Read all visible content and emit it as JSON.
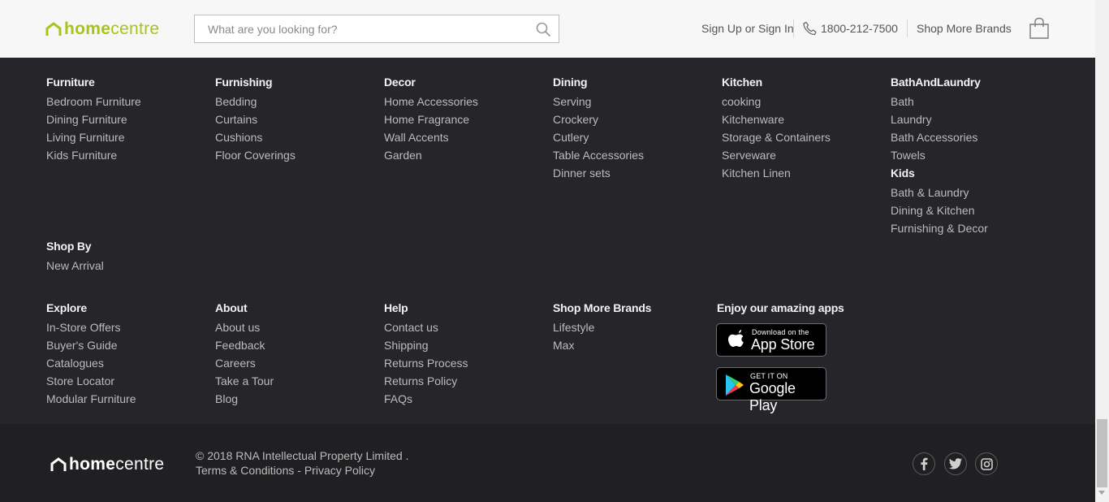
{
  "header": {
    "logo_bold": "home",
    "logo_thin": "centre",
    "search_placeholder": "What are you looking for?",
    "signin": "Sign Up or Sign In",
    "phone": "1800-212-7500",
    "shop_more": "Shop More Brands",
    "accent_color": "#a8c41a"
  },
  "categories": [
    {
      "heading": "Furniture",
      "links": [
        "Bedroom Furniture",
        "Dining Furniture",
        "Living Furniture",
        "Kids Furniture"
      ]
    },
    {
      "heading": "Furnishing",
      "links": [
        "Bedding",
        "Curtains",
        "Cushions",
        "Floor Coverings"
      ]
    },
    {
      "heading": "Decor",
      "links": [
        "Home Accessories",
        "Home Fragrance",
        "Wall Accents",
        "Garden"
      ]
    },
    {
      "heading": "Dining",
      "links": [
        "Serving",
        "Crockery",
        "Cutlery",
        "Table Accessories",
        "Dinner sets"
      ]
    },
    {
      "heading": "Kitchen",
      "links": [
        "cooking",
        "Kitchenware",
        "Storage & Containers",
        "Serveware",
        "Kitchen Linen"
      ]
    },
    {
      "heading": "BathAndLaundry",
      "links": [
        "Bath",
        "Laundry",
        "Bath Accessories",
        "Towels"
      ]
    }
  ],
  "kids": {
    "heading": "Kids",
    "links": [
      "Bath & Laundry",
      "Dining & Kitchen",
      "Furnishing & Decor"
    ]
  },
  "shop_by": {
    "heading": "Shop By",
    "links": [
      "New Arrival"
    ]
  },
  "info": [
    {
      "heading": "Explore",
      "links": [
        "In-Store Offers",
        "Buyer's Guide",
        "Catalogues",
        "Store Locator",
        "Modular Furniture"
      ]
    },
    {
      "heading": "About",
      "links": [
        "About us",
        "Feedback",
        "Careers",
        "Take a Tour",
        "Blog"
      ]
    },
    {
      "heading": "Help",
      "links": [
        "Contact us",
        "Shipping",
        "Returns Process",
        "Returns Policy",
        "FAQs"
      ]
    },
    {
      "heading": "Shop More Brands",
      "links": [
        "Lifestyle",
        "Max"
      ]
    }
  ],
  "apps": {
    "heading": "Enjoy our amazing apps",
    "appstore_small": "Download on the",
    "appstore_big": "App Store",
    "googleplay_small": "GET IT ON",
    "googleplay_big": "Google Play"
  },
  "bottom": {
    "logo_bold": "home",
    "logo_thin": "centre",
    "copyright": "© 2018 RNA Intellectual Property Limited .",
    "terms": "Terms & Conditions",
    "separator": " - ",
    "privacy": "Privacy Policy",
    "social": [
      "facebook-icon",
      "twitter-icon",
      "instagram-icon"
    ]
  }
}
